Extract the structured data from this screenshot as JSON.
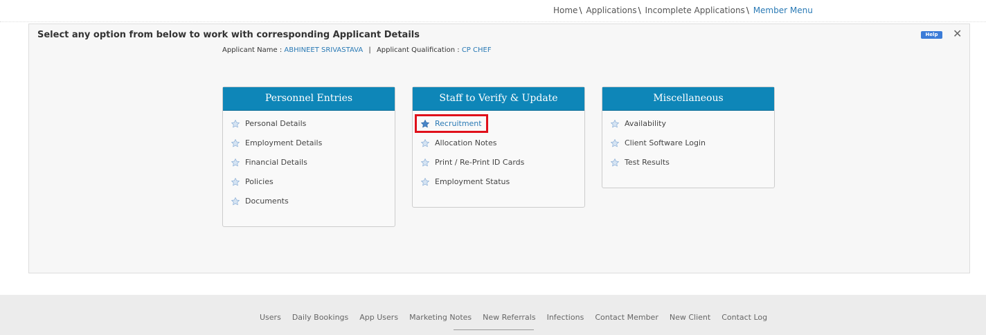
{
  "breadcrumb": {
    "items": [
      "Home",
      "Applications",
      "Incomplete Applications"
    ],
    "current": "Member Menu",
    "separator": "\\"
  },
  "panel": {
    "title": "Select any option from below to work with corresponding Applicant Details",
    "applicant_name_label": "Applicant Name :",
    "applicant_name": "ABHINEET SRIVASTAVA",
    "qualification_label": "Applicant Qualification :",
    "qualification": "CP CHEF",
    "help_label": "Help"
  },
  "cards": {
    "personnel": {
      "title": "Personnel Entries",
      "items": [
        "Personal Details",
        "Employment Details",
        "Financial Details",
        "Policies",
        "Documents"
      ]
    },
    "staff": {
      "title": "Staff to Verify & Update",
      "items": [
        "Recruitment",
        "Allocation Notes",
        "Print / Re-Print ID Cards",
        "Employment Status"
      ]
    },
    "misc": {
      "title": "Miscellaneous",
      "items": [
        "Availability",
        "Client Software Login",
        "Test Results"
      ]
    }
  },
  "footer": {
    "links": [
      "Users",
      "Daily Bookings",
      "App Users",
      "Marketing Notes",
      "New Referrals",
      "Infections",
      "Contact Member",
      "New Client",
      "Contact Log"
    ]
  },
  "colors": {
    "accent": "#0e86b8",
    "link": "#2a7ab5",
    "highlight": "#e0101a"
  },
  "icons": {
    "list_bullet": "star-icon",
    "close": "close-icon"
  }
}
